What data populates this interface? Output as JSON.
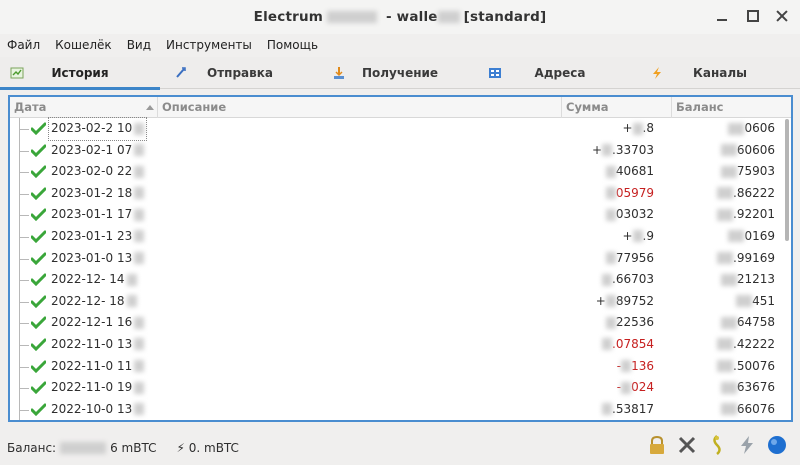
{
  "window": {
    "title": "Electrum [standard]",
    "title_parts": [
      "Electrum",
      "walle",
      "[standard]"
    ]
  },
  "menu": [
    "Файл",
    "Кошелёк",
    "Вид",
    "Инструменты",
    "Помощь"
  ],
  "tabs": [
    {
      "label": "История",
      "icon": "history-icon",
      "active": true
    },
    {
      "label": "Отправка",
      "icon": "send-icon",
      "active": false
    },
    {
      "label": "Получение",
      "icon": "receive-icon",
      "active": false
    },
    {
      "label": "Адреса",
      "icon": "addresses-icon",
      "active": false
    },
    {
      "label": "Каналы",
      "icon": "lightning-icon",
      "active": false
    }
  ],
  "table": {
    "columns": [
      "Дата",
      "Описание",
      "Сумма",
      "Баланс"
    ],
    "sort_column": "Дата",
    "rows": [
      {
        "date": "2023-02-2",
        "time": "10",
        "amount_sign": "+",
        "amount_tail": ".8",
        "balance_tail": "0606",
        "negative": false
      },
      {
        "date": "2023-02-1",
        "time": "07",
        "amount_sign": "+",
        "amount_tail": ".33703",
        "balance_tail": "60606",
        "negative": false
      },
      {
        "date": "2023-02-0",
        "time": "22",
        "amount_sign": "",
        "amount_tail": "40681",
        "balance_tail": "75903",
        "negative": false
      },
      {
        "date": "2023-01-2",
        "time": "18",
        "amount_sign": "",
        "amount_tail": "05979",
        "balance_tail": ".86222",
        "negative": true
      },
      {
        "date": "2023-01-1",
        "time": "17",
        "amount_sign": "",
        "amount_tail": "03032",
        "balance_tail": ".92201",
        "negative": false
      },
      {
        "date": "2023-01-1",
        "time": "23",
        "amount_sign": "+",
        "amount_tail": ".9",
        "balance_tail": "0169",
        "negative": false
      },
      {
        "date": "2023-01-0",
        "time": "13",
        "amount_sign": "",
        "amount_tail": "77956",
        "balance_tail": ".99169",
        "negative": false
      },
      {
        "date": "2022-12-",
        "time": "14",
        "amount_sign": "",
        "amount_tail": ".66703",
        "balance_tail": "21213",
        "negative": false
      },
      {
        "date": "2022-12-",
        "time": "18",
        "amount_sign": "+",
        "amount_tail": "89752",
        "balance_tail": "451",
        "negative": false
      },
      {
        "date": "2022-12-1",
        "time": "16",
        "amount_sign": "",
        "amount_tail": "22536",
        "balance_tail": "64758",
        "negative": false
      },
      {
        "date": "2022-11-0",
        "time": "13",
        "amount_sign": "",
        "amount_tail": ".07854",
        "balance_tail": ".42222",
        "negative": true
      },
      {
        "date": "2022-11-0",
        "time": "11",
        "amount_sign": "-",
        "amount_tail": "136",
        "balance_tail": ".50076",
        "negative": true
      },
      {
        "date": "2022-11-0",
        "time": "19",
        "amount_sign": "-",
        "amount_tail": "024",
        "balance_tail": "63676",
        "negative": true
      },
      {
        "date": "2022-10-0",
        "time": "13",
        "amount_sign": "",
        "amount_tail": ".53817",
        "balance_tail": "66076",
        "negative": false
      }
    ]
  },
  "status": {
    "balance_label": "Баланс:",
    "balance_value": "6 mBTC",
    "lightning_label": "⚡ 0. mBTC"
  },
  "status_icons": [
    "lock-icon",
    "tools-icon",
    "seed-icon",
    "lightning-icon",
    "network-status-icon"
  ],
  "colors": {
    "accent": "#3c85c8",
    "negative": "#c62020",
    "check": "#3aa63a"
  }
}
